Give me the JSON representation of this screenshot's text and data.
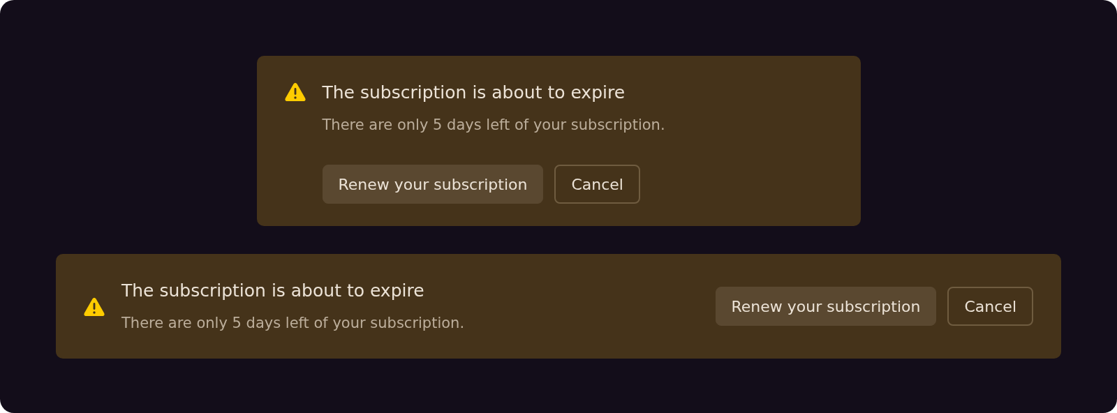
{
  "banners": [
    {
      "kind": "stacked",
      "title": "The subscription is about to expire",
      "text": "There are only 5 days left of your subscription.",
      "buttons": [
        {
          "label": "Renew your subscription",
          "kind": "filled"
        },
        {
          "label": "Cancel",
          "kind": "outline"
        }
      ]
    },
    {
      "kind": "inline",
      "title": "The subscription is about to expire",
      "text": "There are only 5 days left of your subscription.",
      "buttons": [
        {
          "label": "Renew your subscription",
          "kind": "filled"
        },
        {
          "label": "Cancel",
          "kind": "outline"
        }
      ]
    }
  ]
}
